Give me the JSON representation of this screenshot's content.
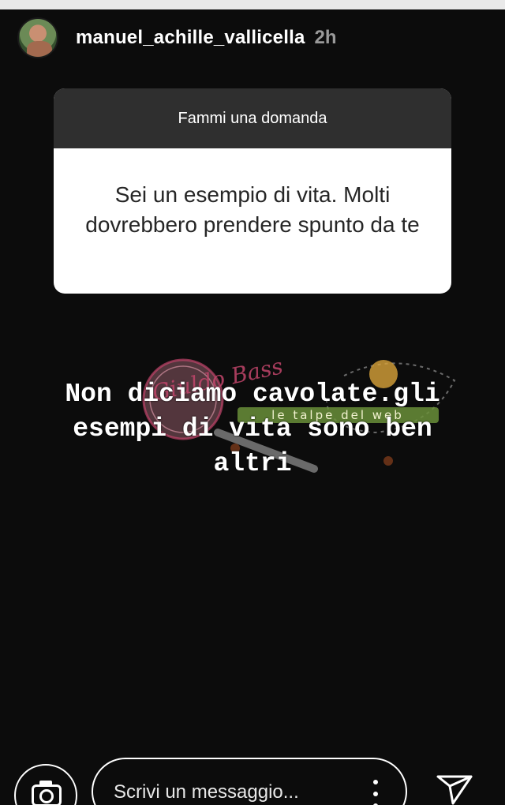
{
  "story": {
    "username": "manuel_achille_vallicella",
    "timestamp": "2h"
  },
  "question_sticker": {
    "header": "Fammi una domanda",
    "question": "Sei un esempio di vita. Molti dovrebbero prendere spunto da te"
  },
  "reply_text": {
    "line1": "Non diciamo cavolate.gli",
    "line2": "esempi di vita sono ben",
    "line3": "altri"
  },
  "watermark": {
    "script_text": "Giuldo Bass",
    "banner_text": "le talpe del web"
  },
  "footer": {
    "message_placeholder": "Scrivi un messaggio...",
    "camera_icon": "camera-icon",
    "more_icon": "more-vertical-icon",
    "send_icon": "send-icon"
  },
  "colors": {
    "background": "#0c0c0c",
    "card_header": "#2f2f2f",
    "card_body": "#ffffff",
    "progress": "#e9e9e9"
  }
}
